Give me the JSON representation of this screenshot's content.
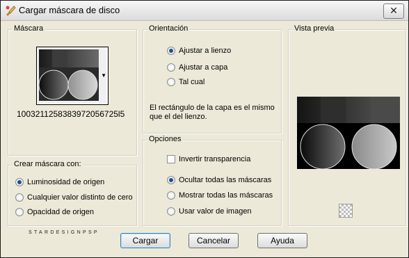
{
  "window": {
    "title": "Cargar máscara de disco",
    "close_label": "✕"
  },
  "mask_group": {
    "label": "Máscara",
    "filename": "1003211258383972056725l5"
  },
  "orientation_group": {
    "label": "Orientación",
    "options": [
      "Ajustar a lienzo",
      "Ajustar a capa",
      "Tal cual"
    ],
    "selected": "Ajustar a lienzo",
    "note": "El rectángulo de la capa es el mismo que el del lienzo."
  },
  "options_group": {
    "label": "Opciones",
    "invert_label": "Invertir transparencia",
    "invert_checked": false,
    "visibility_options": [
      "Ocultar todas las máscaras",
      "Mostrar todas las máscaras",
      "Usar valor de imagen"
    ],
    "selected": "Ocultar todas las máscaras"
  },
  "create_group": {
    "label": "Crear máscara con:",
    "options": [
      "Luminosidad de origen",
      "Cualquier valor distinto de cero",
      "Opacidad de origen"
    ],
    "selected": "Luminosidad de origen"
  },
  "preview_group": {
    "label": "Vista previa"
  },
  "buttons": {
    "load": "Cargar",
    "cancel": "Cancelar",
    "help": "Ayuda"
  },
  "watermark": "STARDESIGNPSP",
  "icons": {
    "app": "app-brush-icon",
    "dropdown": "chevron-down-icon",
    "dither": "checkerboard-icon"
  }
}
